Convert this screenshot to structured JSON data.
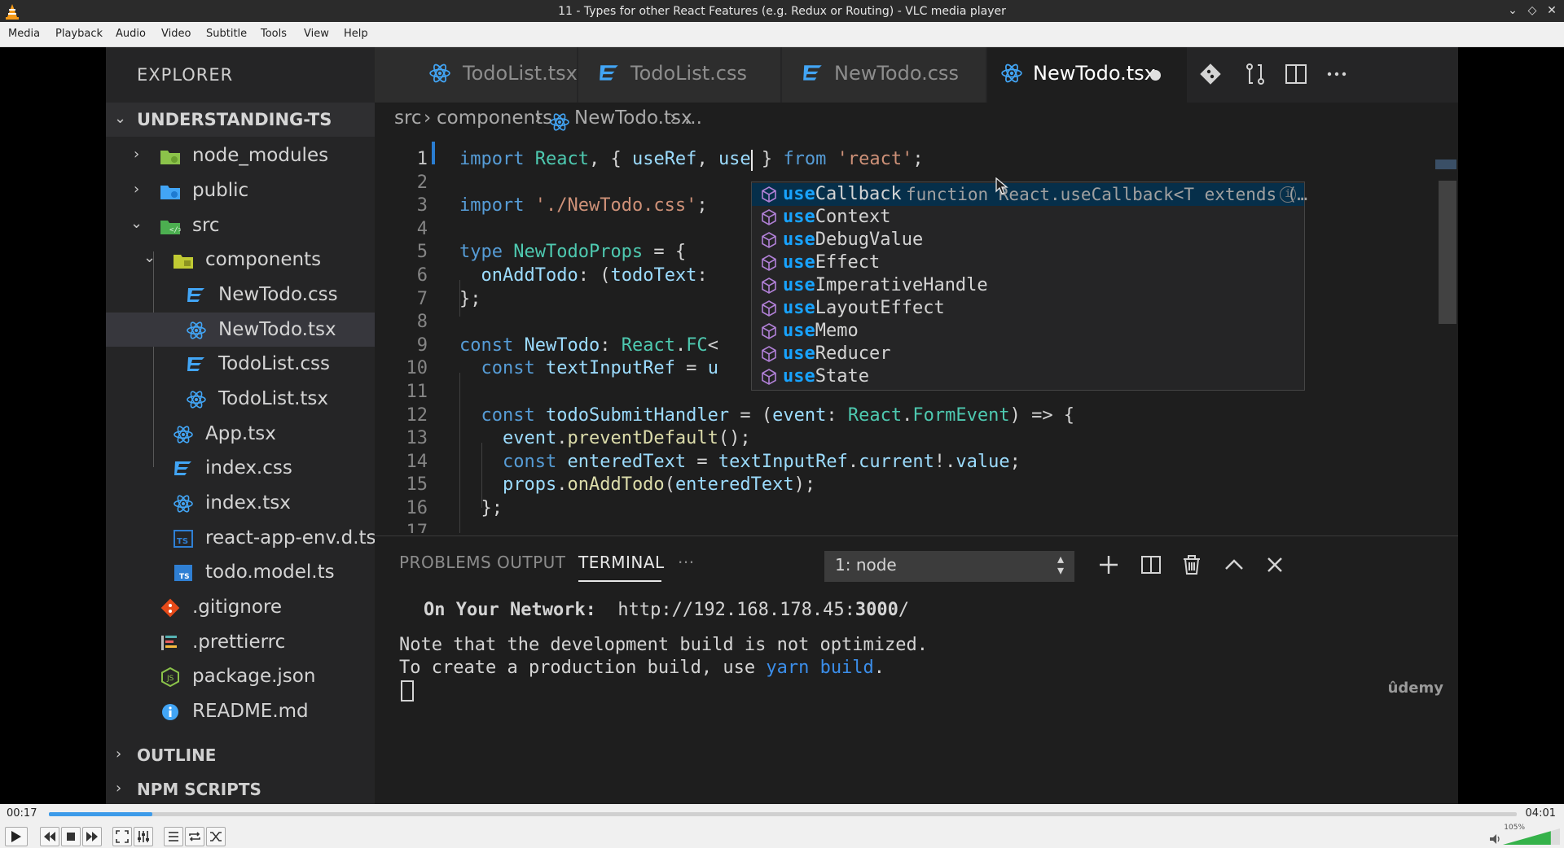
{
  "window": {
    "title": "11 - Types for other React Features (e.g. Redux or Routing) - VLC media player"
  },
  "menu": [
    "Media",
    "Playback",
    "Audio",
    "Video",
    "Subtitle",
    "Tools",
    "View",
    "Help"
  ],
  "vscode": {
    "sidebar": {
      "title": "EXPLORER",
      "project": "UNDERSTANDING-TS",
      "tree": [
        {
          "label": "node_modules",
          "icon": "folder-node-icon",
          "collapsed": true
        },
        {
          "label": "public",
          "icon": "folder-public-icon",
          "collapsed": true
        },
        {
          "label": "src",
          "icon": "folder-src-icon",
          "collapsed": false
        },
        {
          "label": "components",
          "icon": "folder-components-icon",
          "collapsed": false
        },
        {
          "label": "NewTodo.css",
          "icon": "css-file-icon"
        },
        {
          "label": "NewTodo.tsx",
          "icon": "react-file-icon",
          "selected": true
        },
        {
          "label": "TodoList.css",
          "icon": "css-file-icon"
        },
        {
          "label": "TodoList.tsx",
          "icon": "react-file-icon"
        },
        {
          "label": "App.tsx",
          "icon": "react-file-icon"
        },
        {
          "label": "index.css",
          "icon": "css-file-icon"
        },
        {
          "label": "index.tsx",
          "icon": "react-file-icon"
        },
        {
          "label": "react-app-env.d.ts",
          "icon": "ts-file-icon"
        },
        {
          "label": "todo.model.ts",
          "icon": "ts-file-icon"
        },
        {
          "label": ".gitignore",
          "icon": "git-file-icon"
        },
        {
          "label": ".prettierrc",
          "icon": "prettier-file-icon"
        },
        {
          "label": "package.json",
          "icon": "npm-file-icon"
        },
        {
          "label": "README.md",
          "icon": "info-file-icon"
        }
      ],
      "sections": [
        "OUTLINE",
        "NPM SCRIPTS"
      ]
    },
    "tabs": [
      {
        "label": "TodoList.tsx",
        "icon": "react-file-icon"
      },
      {
        "label": "TodoList.css",
        "icon": "css-file-icon"
      },
      {
        "label": "NewTodo.css",
        "icon": "css-file-icon"
      },
      {
        "label": "NewTodo.tsx",
        "icon": "react-file-icon",
        "active": true,
        "dirty": true
      }
    ],
    "breadcrumb": [
      "src",
      "components",
      "NewTodo.tsx",
      "..."
    ],
    "active_line": 1,
    "code": [
      {
        "n": "1",
        "text": "import React, { useRef, use } from 'react';"
      },
      {
        "n": "2",
        "text": ""
      },
      {
        "n": "3",
        "text": "import './NewTodo.css';"
      },
      {
        "n": "4",
        "text": ""
      },
      {
        "n": "5",
        "text": "type NewTodoProps = {"
      },
      {
        "n": "6",
        "text": "  onAddTodo: (todoText:"
      },
      {
        "n": "7",
        "text": "};"
      },
      {
        "n": "8",
        "text": ""
      },
      {
        "n": "9",
        "text": "const NewTodo: React.FC<"
      },
      {
        "n": "10",
        "text": "  const textInputRef = u"
      },
      {
        "n": "11",
        "text": ""
      },
      {
        "n": "12",
        "text": "  const todoSubmitHandler = (event: React.FormEvent) => {"
      },
      {
        "n": "13",
        "text": "    event.preventDefault();"
      },
      {
        "n": "14",
        "text": "    const enteredText = textInputRef.current!.value;"
      },
      {
        "n": "15",
        "text": "    props.onAddTodo(enteredText);"
      },
      {
        "n": "16",
        "text": "  };"
      },
      {
        "n": "17",
        "text": ""
      }
    ],
    "suggest": {
      "match": "use",
      "items": [
        {
          "label": "Callback",
          "detail": "function React.useCallback<T extends (…",
          "active": true
        },
        {
          "label": "Context"
        },
        {
          "label": "DebugValue"
        },
        {
          "label": "Effect"
        },
        {
          "label": "ImperativeHandle"
        },
        {
          "label": "LayoutEffect"
        },
        {
          "label": "Memo"
        },
        {
          "label": "Reducer"
        },
        {
          "label": "State"
        }
      ]
    },
    "panel": {
      "tabs": [
        "PROBLEMS",
        "OUTPUT",
        "TERMINAL",
        "···"
      ],
      "active_tab": "TERMINAL",
      "terminal_select": "1: node",
      "network_label": "On Your Network:",
      "network_url_prefix": "http://192.168.178.45:",
      "network_url_port": "3000",
      "network_url_suffix": "/",
      "note_line": "Note that the development build is not optimized.",
      "build_line_prefix": "To create a production build, use ",
      "build_cmd": "yarn build",
      "build_line_suffix": ".",
      "watermark": "ûdemy"
    }
  },
  "player": {
    "elapsed": "00:17",
    "total": "04:01",
    "progress": 0.0705,
    "volume_label": "105%",
    "volume": 1.05
  },
  "colors": {
    "seek_fill": "#3d9be9",
    "suggest_match": "#18a3ff",
    "terminal_link": "#3b8eea"
  }
}
